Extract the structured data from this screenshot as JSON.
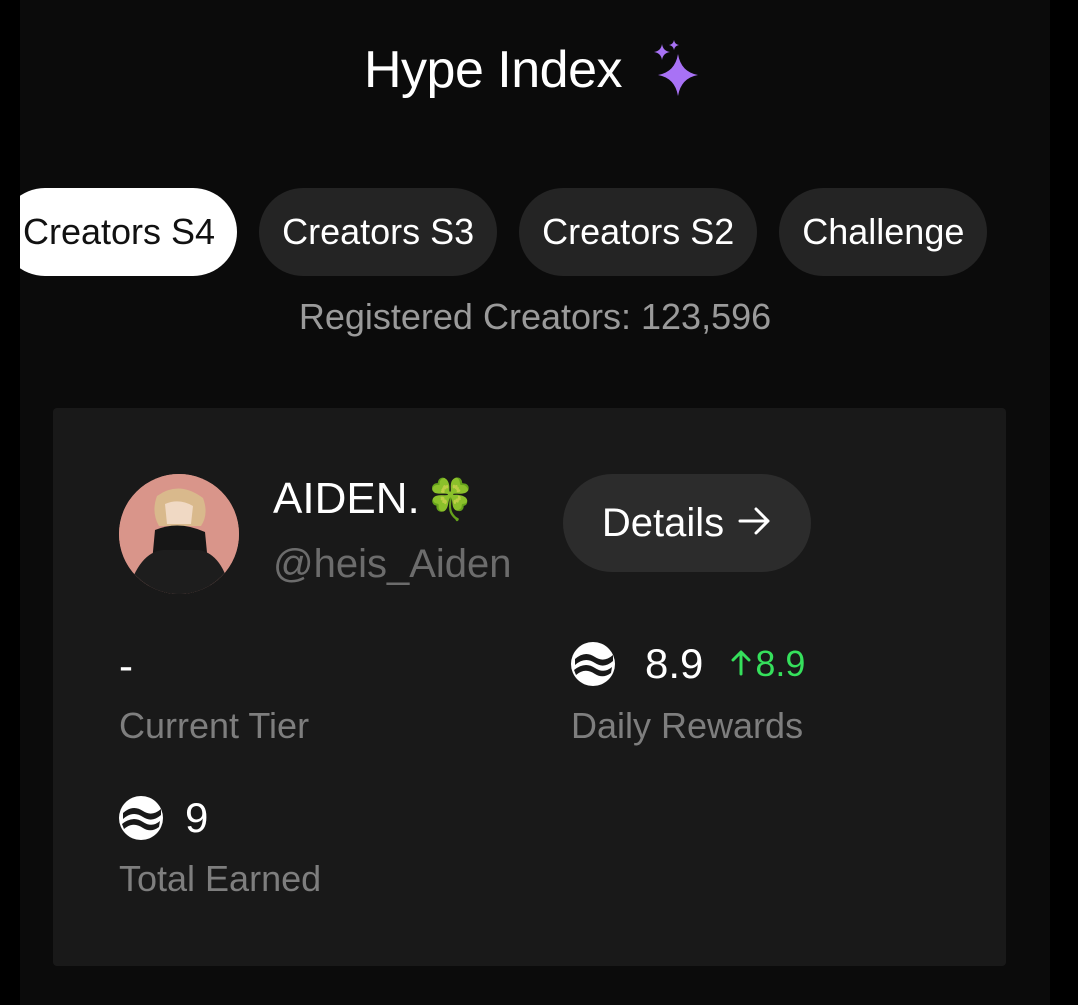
{
  "header": {
    "title": "Hype Index",
    "title_icon": "sparkles-icon",
    "sparkle_color": "#a872f5"
  },
  "tabs": [
    {
      "label": "Creators S4",
      "active": true
    },
    {
      "label": "Creators S3",
      "active": false
    },
    {
      "label": "Creators S2",
      "active": false
    },
    {
      "label": "Challenge",
      "active": false
    }
  ],
  "registered_text": "Registered Creators: 123,596",
  "profile": {
    "name": "AIDEN.",
    "name_emoji": "🍀",
    "handle": "@heis_Aiden",
    "details_label": "Details",
    "details_icon": "arrow-right-icon"
  },
  "stats": {
    "current_tier": {
      "value": "-",
      "label": "Current Tier"
    },
    "daily_rewards": {
      "value": "8.9",
      "delta": "8.9",
      "label": "Daily Rewards",
      "icon": "token-icon",
      "delta_color": "#35e05c"
    },
    "total_earned": {
      "value": "9",
      "label": "Total Earned",
      "icon": "token-icon"
    }
  }
}
